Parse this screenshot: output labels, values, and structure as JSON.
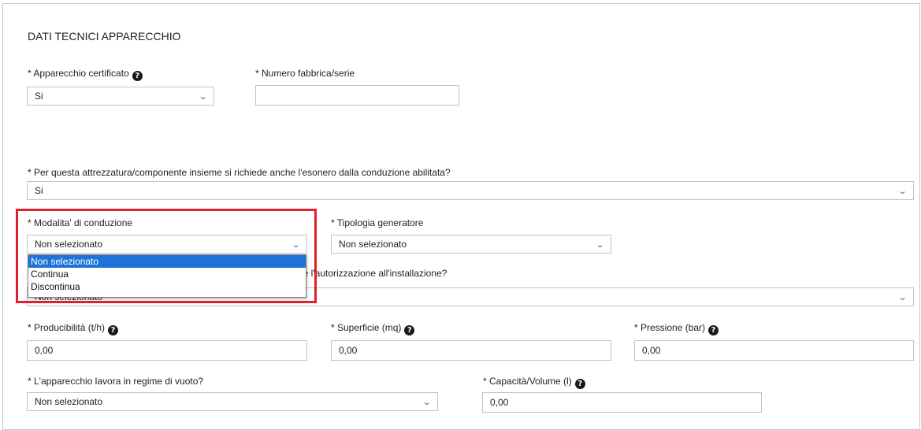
{
  "section_title": "DATI TECNICI APPARECCHIO",
  "fields": {
    "apparecchio_certificato": {
      "label": "* Apparecchio certificato",
      "value": "Si"
    },
    "numero_fabbrica": {
      "label": "* Numero fabbrica/serie",
      "value": ""
    },
    "esonero": {
      "label": "* Per questa attrezzatura/componente insieme si richiede anche l'esonero dalla conduzione abilitata?",
      "value": "Si"
    },
    "modalita_conduzione": {
      "label": "* Modalita' di conduzione",
      "value": "Non selezionato",
      "options": [
        "Non selezionato",
        "Continua",
        "Discontinua"
      ]
    },
    "tipologia_generatore": {
      "label": "* Tipologia generatore",
      "value": "Non selezionato"
    },
    "autorizzazione": {
      "label_visible": "he l'autorizzazione all'installazione?",
      "value": "Non selezionato"
    },
    "producibilita": {
      "label": "* Producibilità (t/h)",
      "value": "0,00"
    },
    "superficie": {
      "label": "* Superficie (mq)",
      "value": "0,00"
    },
    "pressione": {
      "label": "* Pressione (bar)",
      "value": "0,00"
    },
    "regime_vuoto": {
      "label": "* L'apparecchio lavora in regime di vuoto?",
      "value": "Non selezionato"
    },
    "capacita": {
      "label": "* Capacità/Volume (l)",
      "value": "0,00"
    }
  },
  "icons": {
    "help": "question-circle-icon",
    "chevron": "chevron-down-icon"
  },
  "colors": {
    "chevron": "#2a74c4",
    "highlight": "#e0202a",
    "selected_option": "#1e73d8"
  }
}
